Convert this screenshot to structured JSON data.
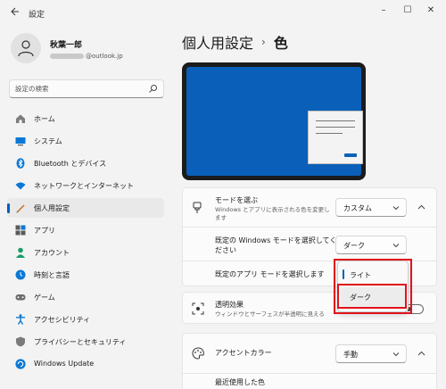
{
  "app": {
    "title": "設定",
    "back_icon": "back-arrow-icon"
  },
  "window_controls": {
    "minimize": "–",
    "maximize": "☐",
    "close": "✕"
  },
  "user": {
    "name": "秋葉一郎",
    "email_suffix": "@outlook.jp"
  },
  "search": {
    "placeholder": "設定の検索"
  },
  "nav": [
    {
      "label": "ホーム",
      "icon": "home-icon"
    },
    {
      "label": "システム",
      "icon": "system-icon"
    },
    {
      "label": "Bluetooth とデバイス",
      "icon": "bluetooth-icon"
    },
    {
      "label": "ネットワークとインターネット",
      "icon": "wifi-icon"
    },
    {
      "label": "個人用設定",
      "icon": "pen-icon",
      "active": true
    },
    {
      "label": "アプリ",
      "icon": "apps-icon"
    },
    {
      "label": "アカウント",
      "icon": "account-icon"
    },
    {
      "label": "時刻と言語",
      "icon": "time-language-icon"
    },
    {
      "label": "ゲーム",
      "icon": "gamepad-icon"
    },
    {
      "label": "アクセシビリティ",
      "icon": "accessibility-icon"
    },
    {
      "label": "プライバシーとセキュリティ",
      "icon": "shield-icon"
    },
    {
      "label": "Windows Update",
      "icon": "update-icon"
    }
  ],
  "breadcrumb": {
    "parent": "個人用設定",
    "separator": "›",
    "current": "色"
  },
  "mode": {
    "title": "モードを選ぶ",
    "description": "Windows とアプリに表示される色を変更します",
    "value": "カスタム",
    "windows_mode_label": "既定の Windows モードを選択してください",
    "windows_mode_value": "ダーク",
    "app_mode_label": "既定のアプリ モードを選択します"
  },
  "app_mode_menu": {
    "options": [
      "ライト",
      "ダーク"
    ],
    "selected": "ライト",
    "hovered": "ダーク"
  },
  "transparency": {
    "title": "透明効果",
    "description": "ウィンドウとサーフェスが半透明に見える",
    "state": "オフ"
  },
  "accent": {
    "title": "アクセントカラー",
    "value": "手動",
    "recent_label": "最近使用した色"
  },
  "colors": {
    "accent": "#005fb8",
    "highlight": "#e0131b",
    "preview_bg": "#0a5fb8"
  }
}
